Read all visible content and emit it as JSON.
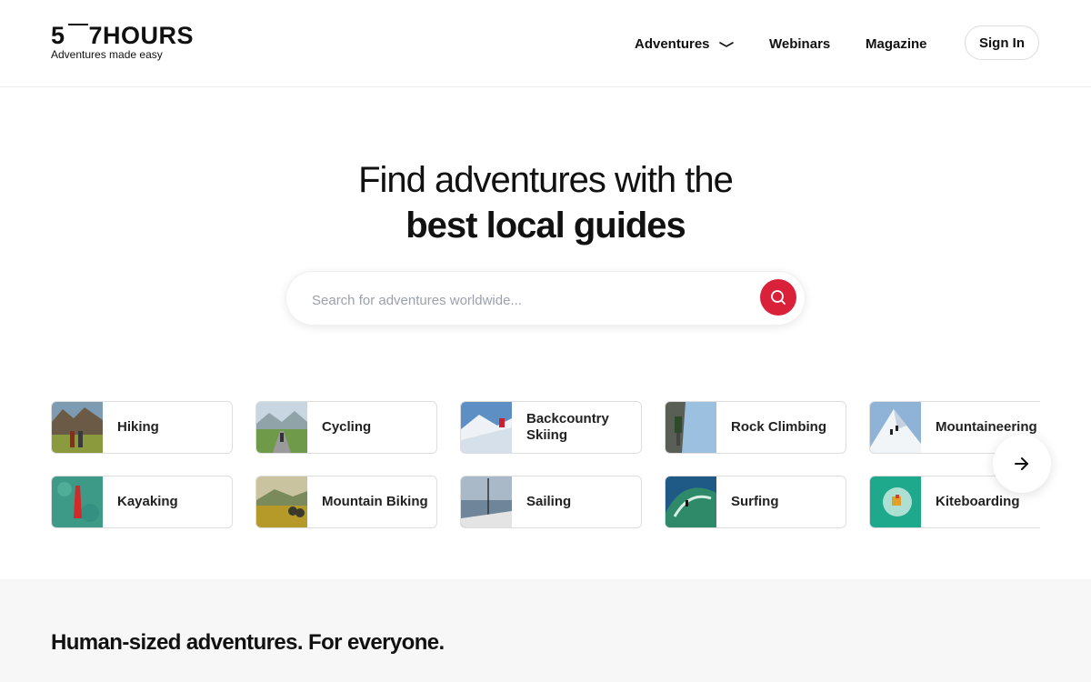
{
  "brand": {
    "logo_left": "5",
    "logo_right": "7HOURS",
    "tagline": "Adventures made easy"
  },
  "nav": {
    "adventures": "Adventures",
    "webinars": "Webinars",
    "magazine": "Magazine",
    "sign_in": "Sign In"
  },
  "hero": {
    "line1": "Find adventures with the",
    "line2": "best local guides"
  },
  "search": {
    "placeholder": "Search for adventures worldwide...",
    "value": ""
  },
  "categories": [
    {
      "label": "Hiking",
      "icon": "hiking-photo"
    },
    {
      "label": "Cycling",
      "icon": "cycling-photo"
    },
    {
      "label": "Backcountry Skiing",
      "icon": "backcountry-skiing-photo"
    },
    {
      "label": "Rock Climbing",
      "icon": "rock-climbing-photo"
    },
    {
      "label": "Mountaineering",
      "icon": "mountaineering-photo"
    },
    {
      "label": "Kayaking",
      "icon": "kayaking-photo"
    },
    {
      "label": "Mountain Biking",
      "icon": "mountain-biking-photo"
    },
    {
      "label": "Sailing",
      "icon": "sailing-photo"
    },
    {
      "label": "Surfing",
      "icon": "surfing-photo"
    },
    {
      "label": "Kiteboarding",
      "icon": "kiteboarding-photo"
    }
  ],
  "section": {
    "title": "Human-sized adventures. For everyone."
  },
  "colors": {
    "accent": "#d9213a",
    "section_bg": "#f7f7f7",
    "text": "#111111"
  }
}
